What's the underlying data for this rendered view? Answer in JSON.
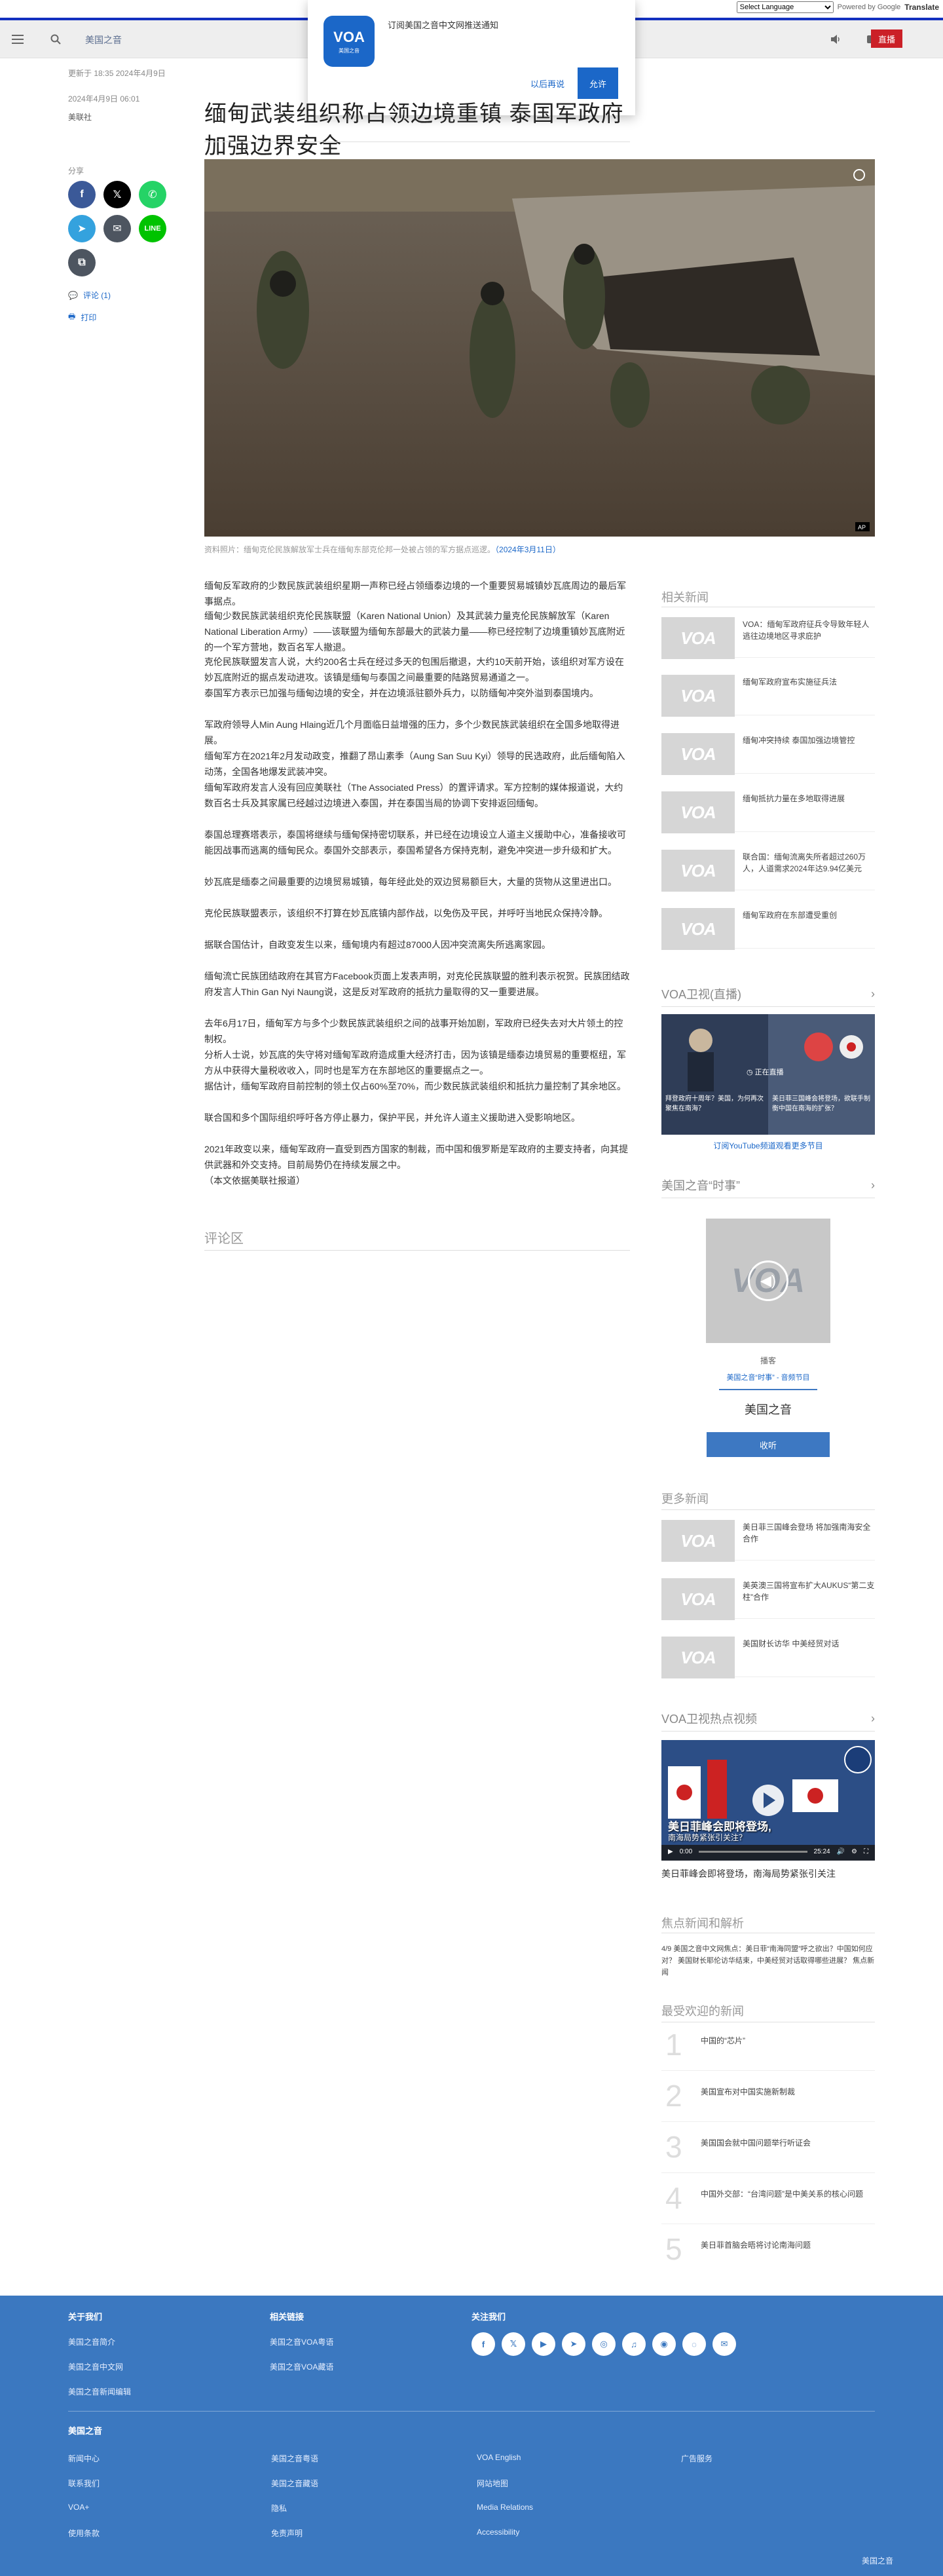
{
  "translate": {
    "select_label": "Select Language",
    "powered_by": "Powered by",
    "google": "Google",
    "translate": "Translate"
  },
  "header": {
    "site_label": "美国之音",
    "live_label": "直播"
  },
  "popup": {
    "message": "订阅美国之音中文网推送通知",
    "later": "以后再说",
    "allow": "允许",
    "logo_text": "VOA",
    "logo_sub": "美国之音"
  },
  "meta": {
    "updated": "更新于 18:35 2024年4月9日",
    "published": "2024年4月9日 06:01",
    "author": "美联社"
  },
  "article": {
    "title": "缅甸武装组织称占领边境重镇 泰国军政府加强边界安全",
    "share_label": "分享",
    "comments_link": "评论 (1)",
    "print_link": "打印",
    "caption_main": "资料照片：缅甸克伦民族解放军士兵在缅甸东部克伦邦一处被占领的军方据点巡逻。",
    "caption_date": "（2024年3月11日）",
    "paragraphs": [
      "缅甸反军政府的少数民族武装组织星期一声称已经占领缅泰边境的一个重要贸易城镇妙瓦底周边的最后军事据点。",
      "缅甸少数民族武装组织克伦民族联盟（Karen National Union）及其武装力量克伦民族解放军（Karen National Liberation Army）——该联盟为缅甸东部最大的武装力量——称已经控制了边境重镇妙瓦底附近的一个军方营地，数百名军人撤退。",
      "克伦民族联盟发言人说，大约200名士兵在经过多天的包围后撤退，大约10天前开始，该组织对军方设在妙瓦底附近的据点发动进攻。该镇是缅甸与泰国之间最重要的陆路贸易通道之一。",
      "泰国军方表示已加强与缅甸边境的安全，并在边境派驻额外兵力，以防缅甸冲突外溢到泰国境内。",
      "军政府领导人Min Aung Hlaing近几个月面临日益增强的压力，多个少数民族武装组织在全国多地取得进展。",
      "缅甸军方在2021年2月发动政变，推翻了昂山素季（Aung San Suu Kyi）领导的民选政府，此后缅甸陷入动荡，全国各地爆发武装冲突。",
      "缅甸军政府发言人没有回应美联社（The Associated Press）的置评请求。军方控制的媒体报道说，大约数百名士兵及其家属已经越过边境进入泰国，并在泰国当局的协调下安排返回缅甸。",
      "泰国总理赛塔表示，泰国将继续与缅甸保持密切联系，并已经在边境设立人道主义援助中心，准备接收可能因战事而逃离的缅甸民众。泰国外交部表示，泰国希望各方保持克制，避免冲突进一步升级和扩大。",
      "妙瓦底是缅泰之间最重要的边境贸易城镇，每年经此处的双边贸易额巨大，大量的货物从这里进出口。",
      "克伦民族联盟表示，该组织不打算在妙瓦底镇内部作战，以免伤及平民，并呼吁当地民众保持冷静。",
      "据联合国估计，自政变发生以来，缅甸境内有超过87000人因冲突流离失所逃离家园。",
      "缅甸流亡民族团结政府在其官方Facebook页面上发表声明，对克伦民族联盟的胜利表示祝贺。民族团结政府发言人Thin Gan Nyi Naung说，这是反对军政府的抵抗力量取得的又一重要进展。",
      "去年6月17日，缅甸军方与多个少数民族武装组织之间的战事开始加剧，军政府已经失去对大片领土的控制权。",
      "分析人士说，妙瓦底的失守将对缅甸军政府造成重大经济打击，因为该镇是缅泰边境贸易的重要枢纽，军方从中获得大量税收收入，同时也是军方在东部地区的重要据点之一。",
      "据估计，缅甸军政府目前控制的领土仅占60%至70%，而少数民族武装组织和抵抗力量控制了其余地区。",
      "联合国和多个国际组织呼吁各方停止暴力，保护平民，并允许人道主义援助进入受影响地区。",
      "2021年政变以来，缅甸军政府一直受到西方国家的制裁，而中国和俄罗斯是军政府的主要支持者，向其提供武器和外交支持。目前局势仍在持续发展之中。",
      "（本文依据美联社报道）"
    ],
    "comments_title": "评论区"
  },
  "rail": {
    "related_title": "相关新闻",
    "related": [
      "VOA：缅甸军政府征兵令导致年轻人逃往边境地区寻求庇护",
      "缅甸军政府宣布实施征兵法",
      "缅甸冲突持续 泰国加强边境管控",
      "缅甸抵抗力量在多地取得进展",
      "联合国：缅甸流离失所者超过260万人，人道需求2024年达9.94亿美元",
      "缅甸军政府在东部遭受重创"
    ],
    "video_title": "VOA卫视(直播)",
    "video_caption": "正在直播",
    "yt_link": "订阅YouTube频道观看更多节目",
    "left_panel_text": "拜登政府十周年？美国，为何再次聚焦在南海？",
    "right_panel_text": "美日菲三国峰会将登场，欲联手制衡中国在南海的扩张？",
    "audio_title": "美国之音“时事”",
    "audio_label": "播客",
    "audio_sub": "美国之音“时事” - 音频节目",
    "audio_name": "美国之音",
    "listen_label": "收听",
    "more_title": "更多新闻",
    "more": [
      "美日菲三国峰会登场 将加强南海安全合作",
      "美英澳三国将宣布扩大AUKUS“第二支柱”合作",
      "美国财长访华 中美经贸对话"
    ],
    "player_title": "VOA卫视热点视频",
    "player_caption": "美日菲峰会即将登场，南海局势紧张引关注",
    "player_time": "0:00",
    "player_duration": "25:24",
    "player_overlay": "美日菲峰会即将登场,",
    "player_overlay2": "南海局势紧张引关注？",
    "focus_title": "焦点新闻和解析",
    "focus_text": "4/9 美国之音中文网焦点：美日菲“南海同盟”呼之欲出？中国如何应对？ 美国财长耶伦访华结束，中美经贸对话取得哪些进展？ 焦点新闻",
    "popular_title": "最受欢迎的新闻",
    "popular": [
      {
        "rank": "1",
        "text": "中国的“芯片”"
      },
      {
        "rank": "2",
        "text": "美国宣布对中国实施新制裁"
      },
      {
        "rank": "3",
        "text": "美国国会就中国问题举行听证会"
      },
      {
        "rank": "4",
        "text": "中国外交部：“台湾问题”是中美关系的核心问题"
      },
      {
        "rank": "5",
        "text": "美日菲首脑会晤将讨论南海问题"
      }
    ]
  },
  "footer": {
    "col1_title": "关于我们",
    "col1": [
      "美国之音简介",
      "美国之音中文网",
      "美国之音新闻编辑"
    ],
    "col2_title": "相关链接",
    "col2": [
      "美国之音VOA粤语",
      "美国之音VOA藏语"
    ],
    "col3_title": "关注我们",
    "social": [
      "facebook-icon",
      "x-icon",
      "youtube-icon",
      "telegram-icon",
      "instagram-icon",
      "podcast-icon",
      "rss-icon",
      "wechat-icon",
      "email-icon"
    ],
    "bottom_title": "美国之音",
    "bottom": [
      [
        "新闻中心",
        "美国之音粤语",
        "VOA English",
        "广告服务"
      ],
      [
        "联系我们",
        "美国之音藏语",
        "网站地图"
      ],
      [
        "VOA+",
        "隐私",
        "Media Relations"
      ],
      [
        "使用条款",
        "免责声明",
        "Accessibility"
      ]
    ],
    "copyright": "美国之音"
  }
}
